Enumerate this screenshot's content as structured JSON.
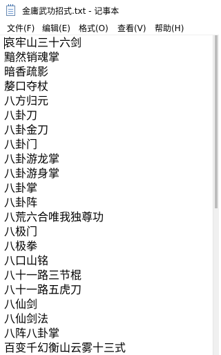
{
  "window": {
    "title": "金庸武功招式.txt - 记事本",
    "icon": "notepad-icon"
  },
  "menu": [
    {
      "label": "文件(F)"
    },
    {
      "label": "编辑(E)"
    },
    {
      "label": "格式(O)"
    },
    {
      "label": "查看(V)"
    },
    {
      "label": "帮助(H)"
    }
  ],
  "document": {
    "lines": [
      "哀牢山三十六剑",
      "黯然销魂掌",
      "暗香疏影",
      "嫠口夺杖",
      "八方归元",
      "八卦刀",
      "八卦金刀",
      "八卦门",
      "八卦游龙掌",
      "八卦游身掌",
      "八卦掌",
      "八卦阵",
      "八荒六合唯我独尊功",
      "八极门",
      "八极拳",
      "八口山铭",
      "八十一路三节棍",
      "八十一路五虎刀",
      "八仙剑",
      "八仙剑法",
      "八阵八卦掌",
      "百变千幻衡山云雾十三式"
    ]
  }
}
